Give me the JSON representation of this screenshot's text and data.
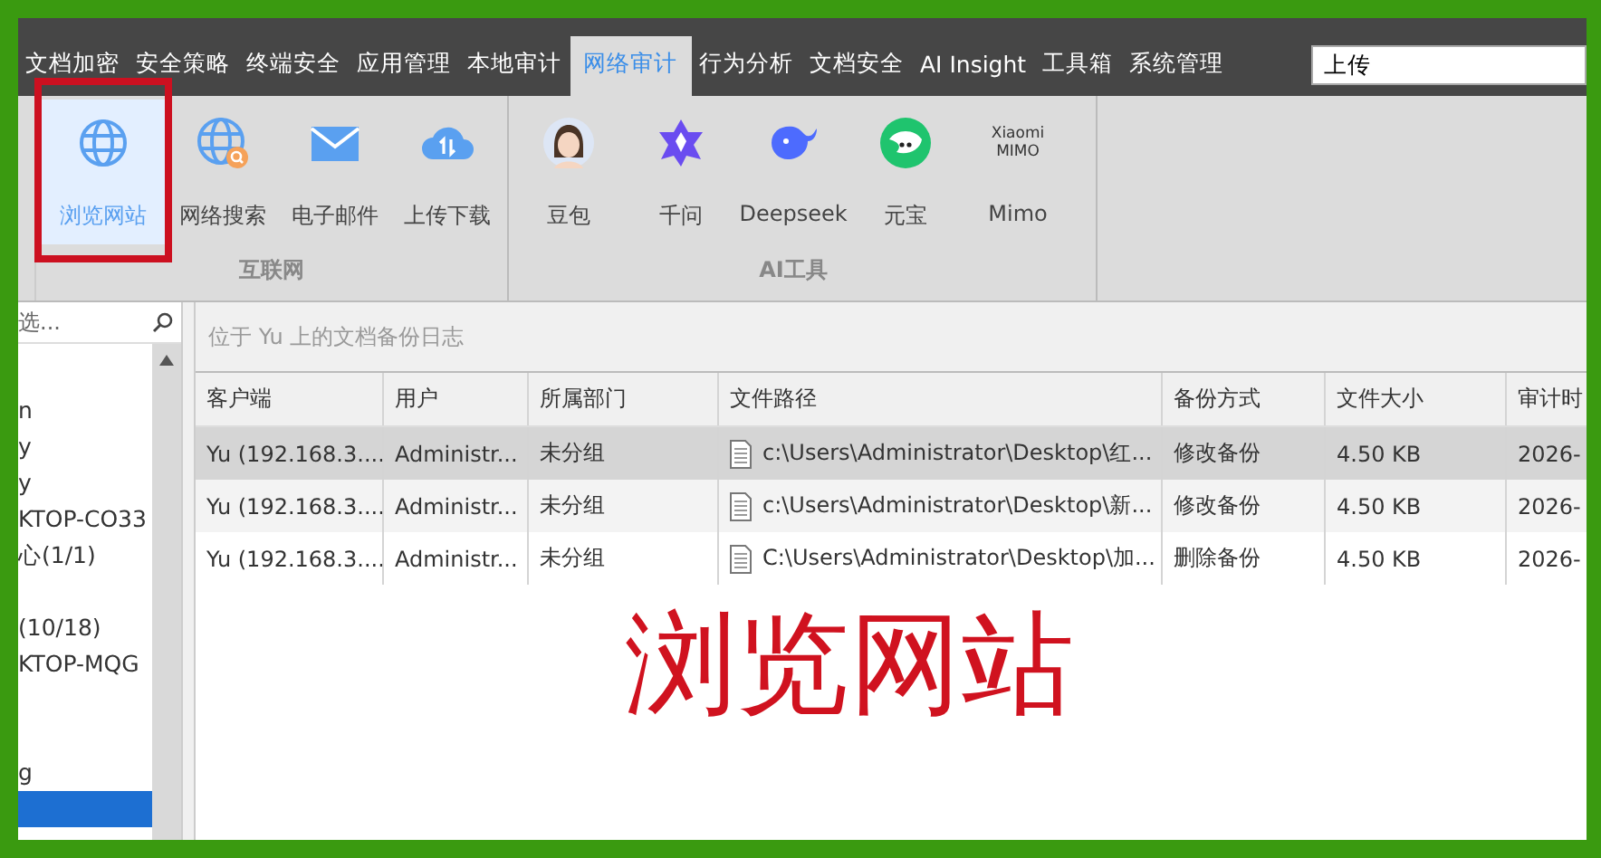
{
  "menu_tabs": [
    {
      "label": "文档加密",
      "selected": false
    },
    {
      "label": "安全策略",
      "selected": false
    },
    {
      "label": "终端安全",
      "selected": false
    },
    {
      "label": "应用管理",
      "selected": false
    },
    {
      "label": "本地审计",
      "selected": false
    },
    {
      "label": "网络审计",
      "selected": true
    },
    {
      "label": "行为分析",
      "selected": false
    },
    {
      "label": "文档安全",
      "selected": false
    },
    {
      "label": "AI Insight",
      "selected": false
    },
    {
      "label": "工具箱",
      "selected": false
    },
    {
      "label": "系统管理",
      "selected": false
    }
  ],
  "search": {
    "value": "上传"
  },
  "ribbon_groups": [
    {
      "label": "互联网",
      "buttons": [
        {
          "label": "浏览网站",
          "selected": true,
          "marked": true
        },
        {
          "label": "网络搜索",
          "selected": false,
          "marked": false
        },
        {
          "label": "电子邮件",
          "selected": false,
          "marked": false
        },
        {
          "label": "上传下载",
          "selected": false,
          "marked": false
        }
      ]
    },
    {
      "label": "AI工具",
      "buttons": [
        {
          "label": "豆包",
          "selected": false,
          "marked": false
        },
        {
          "label": "千问",
          "selected": false,
          "marked": false
        },
        {
          "label": "Deepseek",
          "selected": false,
          "marked": false
        },
        {
          "label": "元宝",
          "selected": false,
          "marked": false
        },
        {
          "label": "Mimo",
          "icon_text": [
            "Xiaomi",
            "MIMO"
          ],
          "selected": false,
          "marked": false
        }
      ]
    }
  ],
  "sidebar": {
    "filter_placeholder": "选...",
    "items": [
      {
        "selected": false
      },
      {
        "label": "n",
        "selected": false
      },
      {
        "label": "y",
        "selected": false
      },
      {
        "label": "y",
        "selected": false
      },
      {
        "label": "KTOP-CO33",
        "selected": false
      },
      {
        "label": "心(1/1)",
        "selected": false
      },
      {
        "selected": false
      },
      {
        "label": "(10/18)",
        "selected": false
      },
      {
        "label": "KTOP-MQG",
        "selected": false
      },
      {
        "selected": false
      },
      {
        "selected": false
      },
      {
        "label": "g",
        "selected": false
      },
      {
        "selected": true
      }
    ]
  },
  "log_title": "位于 Yu 上的文档备份日志",
  "table": {
    "columns": [
      "客户端",
      "用户",
      "所属部门",
      "文件路径",
      "备份方式",
      "文件大小",
      "审计时"
    ],
    "rows": [
      {
        "selected": true,
        "cells": [
          "Yu (192.168.3....",
          "Administr...",
          "未分组",
          "c:\\Users\\Administrator\\Desktop\\红...",
          "修改备份",
          "4.50 KB",
          "2026-"
        ]
      },
      {
        "selected": false,
        "cells": [
          "Yu (192.168.3....",
          "Administr...",
          "未分组",
          "c:\\Users\\Administrator\\Desktop\\新...",
          "修改备份",
          "4.50 KB",
          "2026-"
        ]
      },
      {
        "selected": false,
        "cells": [
          "Yu (192.168.3....",
          "Administr...",
          "未分组",
          "C:\\Users\\Administrator\\Desktop\\加...",
          "删除备份",
          "4.50 KB",
          "2026-"
        ]
      }
    ]
  },
  "annotation": {
    "text": "浏览网站"
  }
}
